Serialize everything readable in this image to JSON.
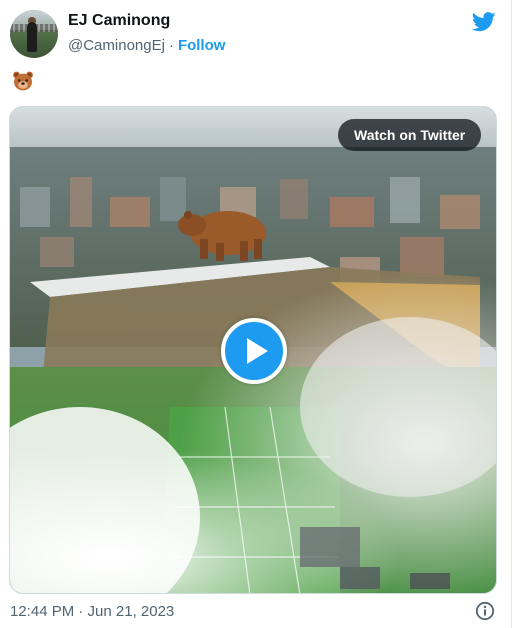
{
  "author": {
    "name": "EJ Caminong",
    "handle": "@CaminongEj",
    "separator": "·",
    "follow_label": "Follow",
    "avatar_icon": "avatar-photo"
  },
  "tweet": {
    "emoji": "bear-face-emoji"
  },
  "media": {
    "watch_label": "Watch on Twitter",
    "play_icon": "play-icon"
  },
  "footer": {
    "timestamp": "12:44 PM · Jun 21, 2023",
    "info_icon": "info-icon"
  },
  "colors": {
    "twitter_blue": "#1d9bf0",
    "text_primary": "#0f1419",
    "text_secondary": "#536471",
    "border": "#cfd9de"
  }
}
